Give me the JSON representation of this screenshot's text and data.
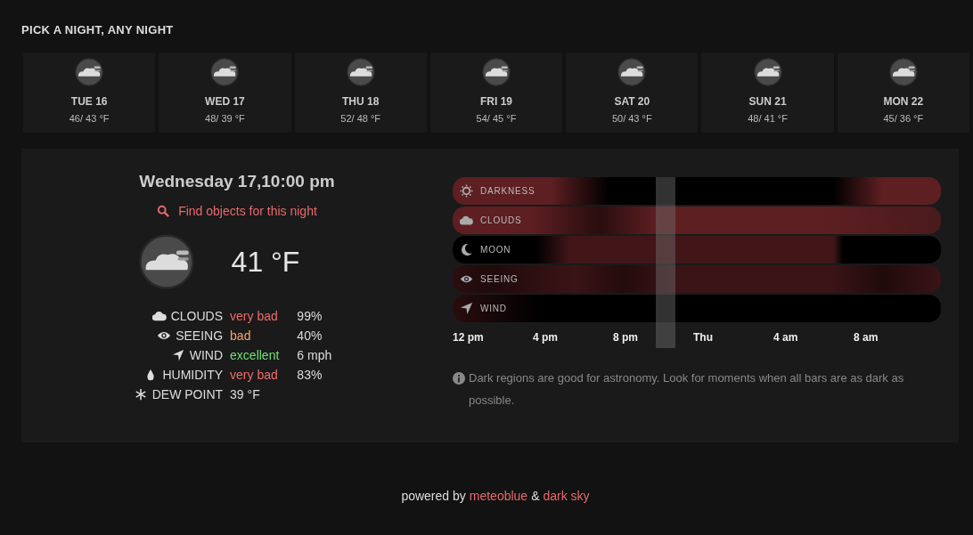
{
  "heading": "PICK A NIGHT, ANY NIGHT",
  "days": [
    {
      "label": "TUE 16",
      "temps": "46/ 43 °F"
    },
    {
      "label": "WED 17",
      "temps": "48/ 39 °F"
    },
    {
      "label": "THU 18",
      "temps": "52/ 48 °F"
    },
    {
      "label": "FRI 19",
      "temps": "54/ 45 °F"
    },
    {
      "label": "SAT 20",
      "temps": "50/ 43 °F"
    },
    {
      "label": "SUN 21",
      "temps": "48/ 41 °F"
    },
    {
      "label": "MON 22",
      "temps": "45/ 36 °F"
    }
  ],
  "detail": {
    "title": "Wednesday 17,10:00 pm",
    "find_link": "Find objects for this night",
    "temperature": "41 °F",
    "conditions": [
      {
        "kind": "clouds",
        "label": "CLOUDS",
        "rating": "very bad",
        "color": "#f06a6a",
        "value": "99%"
      },
      {
        "kind": "seeing",
        "label": "SEEING",
        "rating": "bad",
        "color": "#f7a46b",
        "value": "40%"
      },
      {
        "kind": "wind",
        "label": "WIND",
        "rating": "excellent",
        "color": "#6fe06f",
        "value": "6 mph"
      },
      {
        "kind": "humidity",
        "label": "HUMIDITY",
        "rating": "very bad",
        "color": "#f06a6a",
        "value": "83%"
      },
      {
        "kind": "dew",
        "label": "DEW POINT",
        "rating": "39 °F"
      }
    ]
  },
  "timeline": {
    "rows": [
      {
        "kind": "darkness",
        "label": "DARKNESS"
      },
      {
        "kind": "clouds",
        "label": "CLOUDS"
      },
      {
        "kind": "moon",
        "label": "MOON"
      },
      {
        "kind": "seeing",
        "label": "SEEING"
      },
      {
        "kind": "wind",
        "label": "WIND"
      }
    ],
    "axis": [
      "12 pm",
      "4 pm",
      "8 pm",
      "Thu",
      "4 am",
      "8 am"
    ],
    "note": "Dark regions are good for astronomy. Look for moments when all bars are as dark as possible."
  },
  "footer": {
    "prefix": "powered by",
    "link_1": "meteoblue",
    "joiner": "&",
    "link_2": "dark sky"
  }
}
